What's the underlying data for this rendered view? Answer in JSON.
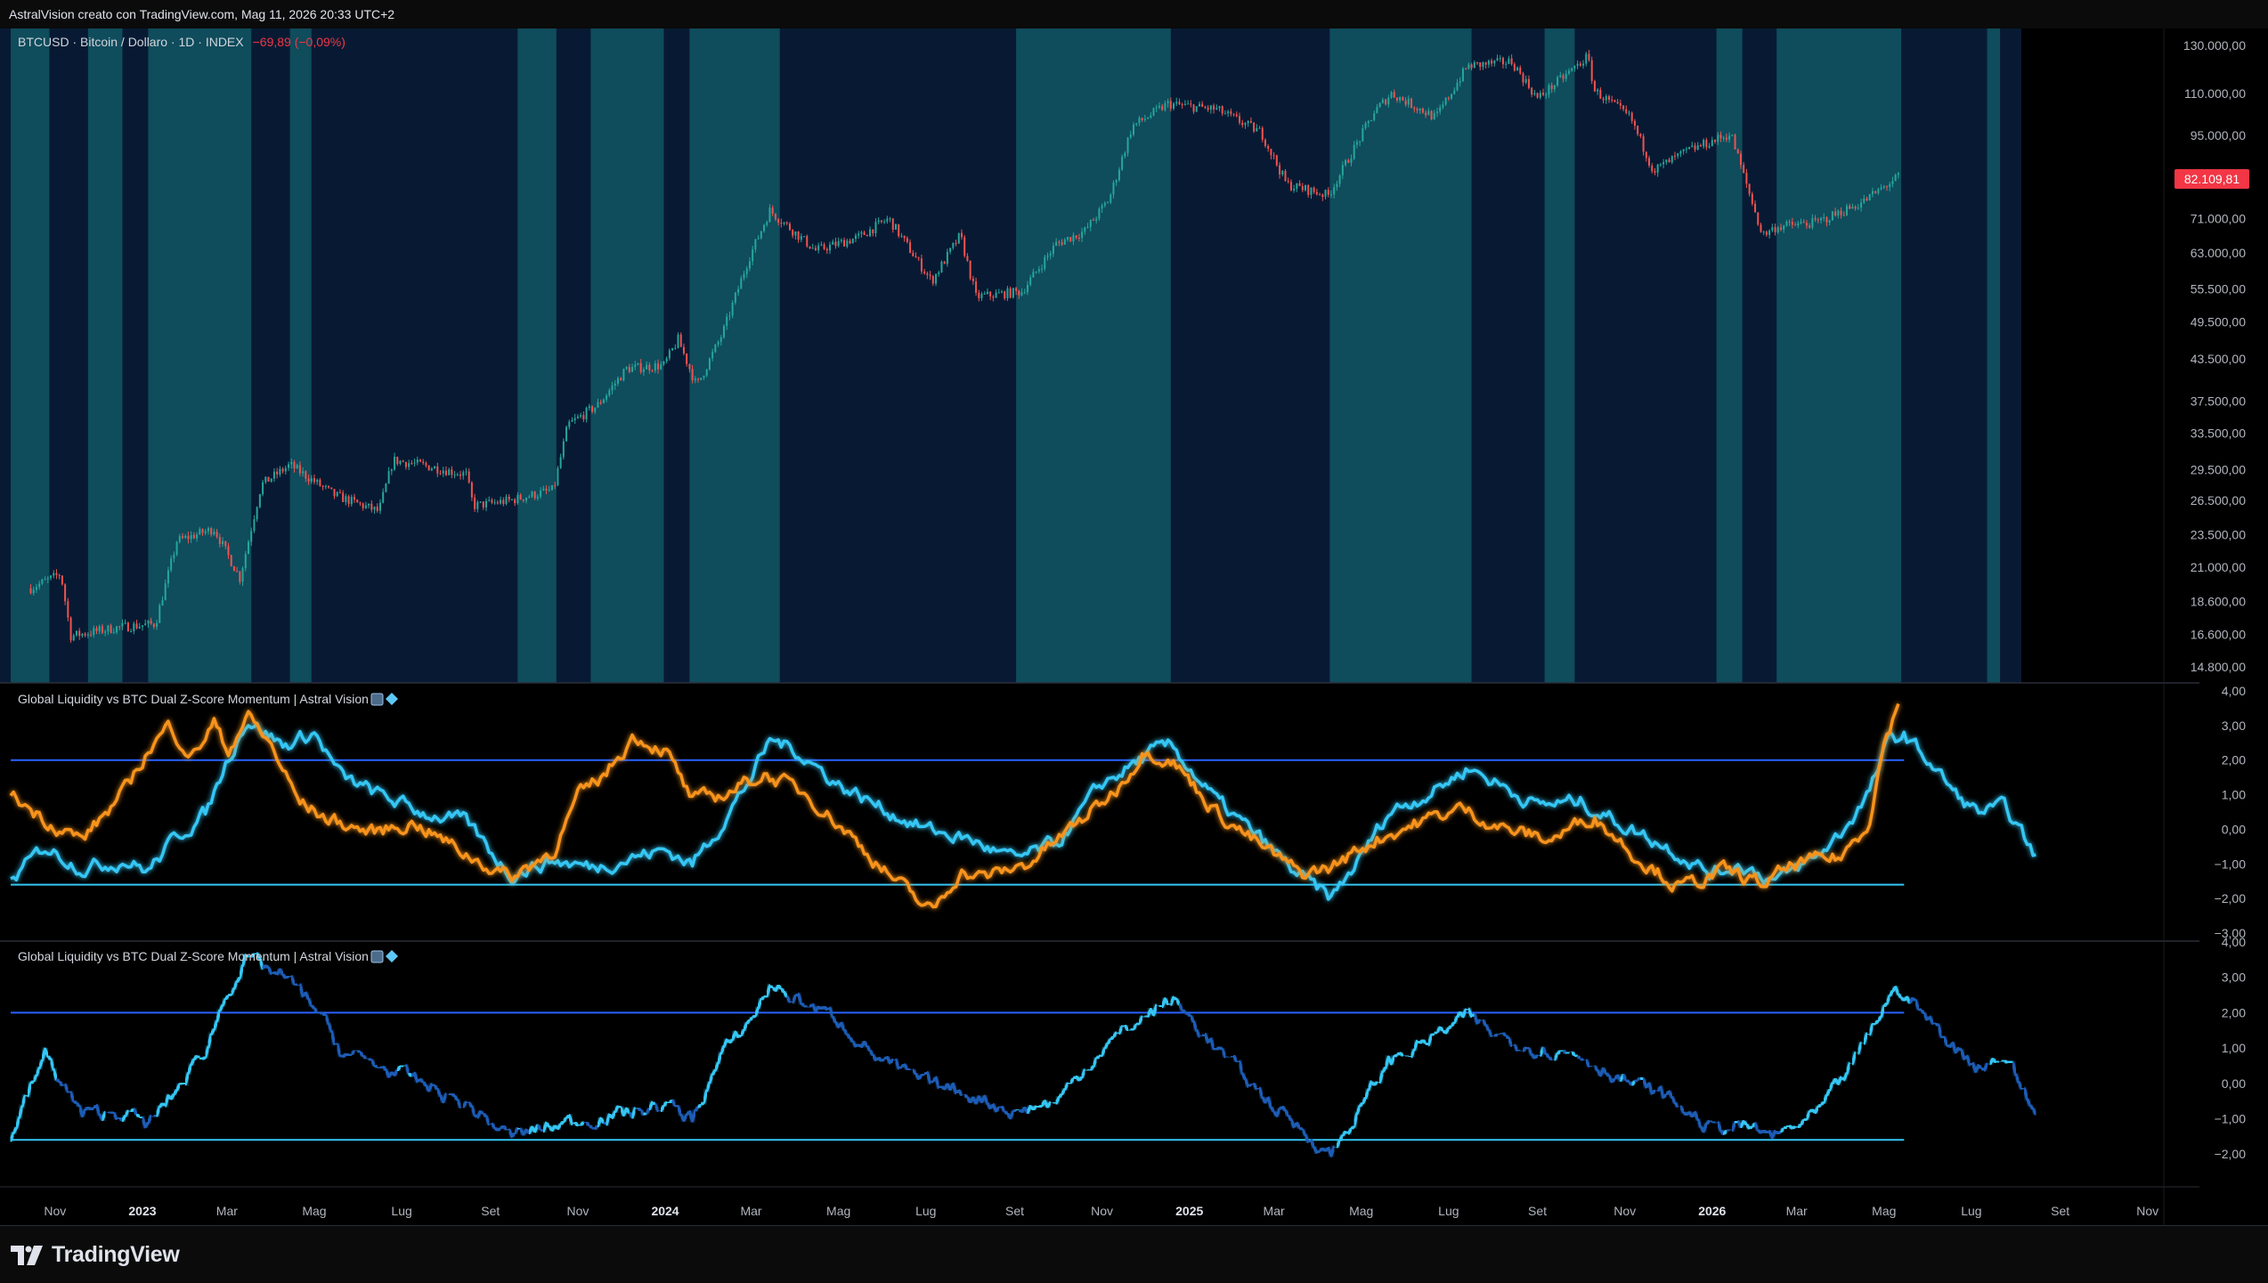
{
  "header": {
    "attribution": "AstralVision creato con TradingView.com, Mag 11, 2026 20:33 UTC+2"
  },
  "main_pane": {
    "legend": "BTCUSD · Bitcoin / Dollaro · 1D · INDEX",
    "change": "−69,89 (−0,09%)",
    "last_price_label": "82.109,81",
    "price_axis_labels": [
      "130.000,00",
      "110.000,00",
      "95.000,00",
      "82.109,81",
      "71.000,00",
      "63.000,00",
      "55.500,00",
      "49.500,00",
      "43.500,00",
      "37.500,00",
      "33.500,00",
      "29.500,00",
      "26.500,00",
      "23.500,00",
      "21.000,00",
      "18.600,00",
      "16.600,00",
      "14.800,00"
    ]
  },
  "pane2": {
    "title": "Global Liquidity vs BTC Dual Z-Score Momentum | Astral Vision",
    "axis_labels": [
      "4,00",
      "3,00",
      "2,00",
      "1,00",
      "0,00",
      "−1,00",
      "−2,00",
      "−3,00"
    ]
  },
  "pane3": {
    "title": "Global Liquidity vs BTC Dual Z-Score Momentum | Astral Vision",
    "axis_labels": [
      "4,00",
      "3,00",
      "2,00",
      "1,00",
      "0,00",
      "−1,00",
      "−2,00"
    ]
  },
  "time_axis": {
    "labels": [
      "Nov",
      "2023",
      "Mar",
      "Mag",
      "Lug",
      "Set",
      "Nov",
      "2024",
      "Mar",
      "Mag",
      "Lug",
      "Set",
      "Nov",
      "2025",
      "Mar",
      "Mag",
      "Lug",
      "Set",
      "Nov",
      "2026",
      "Mar",
      "Mag",
      "Lug",
      "Set",
      "Nov"
    ]
  },
  "footer": {
    "brand": "TradingView"
  },
  "colors": {
    "background": "#000000",
    "regime_teal": "#0f4c5c",
    "regime_navy": "#081a33",
    "candle_up": "#26a69a",
    "candle_down": "#ef5350",
    "price_line": "#b0a7a0",
    "liquidity_z": "#34c6f4",
    "btc_z": "#f7931a",
    "momentum_dark": "#1e5bb5",
    "threshold_line": "#2962ff",
    "last_price_bg": "#f23645"
  },
  "chart_data": [
    {
      "type": "line",
      "title": "BTCUSD · Bitcoin / Dollaro · 1D · INDEX",
      "y_scale": "log",
      "ylim": [
        14000,
        138000
      ],
      "series": [
        {
          "name": "BTCUSD",
          "x": [
            "2022-10-15",
            "2022-11-05",
            "2022-11-12",
            "2022-12-15",
            "2023-01-10",
            "2023-01-25",
            "2023-02-20",
            "2023-03-10",
            "2023-03-25",
            "2023-04-14",
            "2023-05-15",
            "2023-06-15",
            "2023-06-25",
            "2023-07-15",
            "2023-08-15",
            "2023-08-20",
            "2023-09-15",
            "2023-10-15",
            "2023-10-25",
            "2023-11-15",
            "2023-12-05",
            "2023-12-31",
            "2024-01-10",
            "2024-01-23",
            "2024-02-10",
            "2024-02-28",
            "2024-03-14",
            "2024-04-15",
            "2024-05-15",
            "2024-06-05",
            "2024-07-05",
            "2024-07-25",
            "2024-08-05",
            "2024-09-06",
            "2024-09-30",
            "2024-10-20",
            "2024-11-06",
            "2024-11-22",
            "2024-12-17",
            "2025-01-20",
            "2025-02-20",
            "2025-03-10",
            "2025-04-08",
            "2025-05-10",
            "2025-05-22",
            "2025-06-22",
            "2025-07-14",
            "2025-08-14",
            "2025-09-01",
            "2025-10-06",
            "2025-10-11",
            "2025-11-05",
            "2025-11-21",
            "2025-12-15",
            "2026-01-14",
            "2026-02-05",
            "2026-02-15",
            "2026-03-15",
            "2026-04-15",
            "2026-05-11"
          ],
          "y": [
            19500,
            20500,
            16500,
            17000,
            17200,
            23000,
            24000,
            20200,
            28000,
            30000,
            27000,
            25500,
            30500,
            30000,
            29000,
            26000,
            26500,
            27500,
            34500,
            37000,
            42000,
            42500,
            46500,
            39500,
            47500,
            61500,
            73000,
            63500,
            66500,
            71000,
            57000,
            67000,
            54000,
            55000,
            65000,
            68000,
            76000,
            98000,
            106000,
            104000,
            96000,
            80000,
            77000,
            103000,
            110000,
            101000,
            121000,
            123000,
            108000,
            125000,
            111000,
            101000,
            84000,
            90000,
            95500,
            67000,
            69000,
            70000,
            75000,
            82110
          ]
        }
      ]
    },
    {
      "type": "line",
      "title": "Global Liquidity vs BTC Dual Z-Score Momentum | Astral Vision",
      "ylim": [
        -3,
        4
      ],
      "upper_threshold": 2,
      "lower_threshold": -1.6,
      "series": [
        {
          "name": "Global Liquidity",
          "x": [
            "2022-10-01",
            "2022-10-25",
            "2022-11-20",
            "2022-12-20",
            "2023-01-05",
            "2023-01-25",
            "2023-02-15",
            "2023-03-01",
            "2023-03-15",
            "2023-04-10",
            "2023-05-01",
            "2023-05-20",
            "2023-06-15",
            "2023-07-15",
            "2023-08-15",
            "2023-09-15",
            "2023-10-15",
            "2023-11-10",
            "2023-12-10",
            "2024-01-01",
            "2024-01-20",
            "2024-02-10",
            "2024-03-01",
            "2024-03-15",
            "2024-04-01",
            "2024-05-01",
            "2024-06-01",
            "2024-07-01",
            "2024-08-01",
            "2024-09-01",
            "2024-10-01",
            "2024-11-01",
            "2024-12-05",
            "2024-12-20",
            "2025-01-20",
            "2025-02-20",
            "2025-03-20",
            "2025-04-10",
            "2025-05-01",
            "2025-05-20",
            "2025-06-20",
            "2025-07-15",
            "2025-08-01",
            "2025-09-01",
            "2025-10-01",
            "2025-11-01",
            "2025-12-01",
            "2026-01-01",
            "2026-01-20",
            "2026-02-15",
            "2026-03-15",
            "2026-04-01",
            "2026-04-20",
            "2026-05-05",
            "2026-05-15",
            "2026-06-01",
            "2026-06-20",
            "2026-07-05",
            "2026-07-25",
            "2026-08-15"
          ],
          "y": [
            -1.5,
            -0.5,
            -1.1,
            -0.9,
            -1.2,
            -0.2,
            0.5,
            2.0,
            3.2,
            2.4,
            2.8,
            1.5,
            1.0,
            0.5,
            0.2,
            -1.3,
            -0.9,
            -1.1,
            -0.8,
            -0.6,
            -1.0,
            0.2,
            1.5,
            2.6,
            2.3,
            1.3,
            0.6,
            0.0,
            -0.3,
            -0.9,
            -0.4,
            1.3,
            2.2,
            2.4,
            0.8,
            -0.3,
            -1.4,
            -2.0,
            -0.8,
            0.5,
            1.1,
            1.8,
            1.4,
            0.7,
            0.8,
            0.1,
            -0.5,
            -1.3,
            -1.0,
            -1.5,
            -0.8,
            -0.1,
            1.0,
            2.6,
            2.7,
            2.0,
            1.0,
            0.5,
            0.6,
            -0.8
          ]
        },
        {
          "name": "BTC",
          "x": [
            "2022-10-01",
            "2022-10-25",
            "2022-11-20",
            "2022-12-20",
            "2023-01-05",
            "2023-01-20",
            "2023-02-05",
            "2023-02-20",
            "2023-03-01",
            "2023-03-15",
            "2023-04-01",
            "2023-04-20",
            "2023-05-10",
            "2023-06-10",
            "2023-07-10",
            "2023-08-10",
            "2023-09-15",
            "2023-10-15",
            "2023-11-01",
            "2023-11-20",
            "2023-12-10",
            "2024-01-01",
            "2024-01-20",
            "2024-02-10",
            "2024-03-10",
            "2024-04-10",
            "2024-05-10",
            "2024-06-10",
            "2024-07-05",
            "2024-07-25",
            "2024-08-10",
            "2024-09-10",
            "2024-10-10",
            "2024-11-10",
            "2024-12-01",
            "2024-12-20",
            "2025-01-20",
            "2025-02-20",
            "2025-03-20",
            "2025-04-10",
            "2025-05-10",
            "2025-06-10",
            "2025-07-10",
            "2025-08-10",
            "2025-09-10",
            "2025-10-10",
            "2025-11-10",
            "2025-12-10",
            "2026-01-10",
            "2026-02-05",
            "2026-03-01",
            "2026-04-01",
            "2026-04-20",
            "2026-05-01",
            "2026-05-11"
          ],
          "y": [
            1.0,
            0.3,
            -0.3,
            1.1,
            2.3,
            3.0,
            2.1,
            3.1,
            2.2,
            3.3,
            2.4,
            0.8,
            0.3,
            -0.1,
            0.2,
            -0.6,
            -1.4,
            -0.6,
            0.9,
            1.6,
            2.7,
            2.3,
            0.8,
            1.0,
            1.6,
            1.0,
            -0.2,
            -1.5,
            -2.4,
            -1.2,
            -1.4,
            -1.0,
            0.0,
            1.1,
            2.3,
            2.0,
            0.5,
            -0.5,
            -1.3,
            -1.1,
            -0.3,
            0.2,
            0.6,
            0.0,
            -0.3,
            0.4,
            -0.8,
            -1.7,
            -1.2,
            -1.6,
            -1.0,
            -0.8,
            0.2,
            2.5,
            3.6
          ]
        }
      ]
    },
    {
      "type": "line",
      "title": "Global Liquidity vs BTC Dual Z-Score Momentum | Astral Vision",
      "ylim": [
        -2.5,
        4
      ],
      "upper_threshold": 2,
      "lower_threshold": -1.6,
      "series": [
        {
          "name": "Momentum",
          "x": [
            "2022-10-01",
            "2022-10-25",
            "2022-11-20",
            "2022-12-20",
            "2023-01-05",
            "2023-01-25",
            "2023-02-15",
            "2023-03-01",
            "2023-03-15",
            "2023-04-10",
            "2023-05-01",
            "2023-05-20",
            "2023-06-15",
            "2023-07-15",
            "2023-08-15",
            "2023-09-15",
            "2023-10-15",
            "2023-11-10",
            "2023-12-10",
            "2024-01-01",
            "2024-01-20",
            "2024-02-10",
            "2024-03-01",
            "2024-03-15",
            "2024-04-01",
            "2024-05-01",
            "2024-06-01",
            "2024-07-01",
            "2024-08-01",
            "2024-09-01",
            "2024-10-01",
            "2024-11-01",
            "2024-12-05",
            "2024-12-20",
            "2025-01-20",
            "2025-02-20",
            "2025-03-20",
            "2025-04-10",
            "2025-05-01",
            "2025-05-20",
            "2025-06-20",
            "2025-07-15",
            "2025-08-01",
            "2025-09-01",
            "2025-10-01",
            "2025-11-01",
            "2025-12-01",
            "2026-01-01",
            "2026-01-20",
            "2026-02-15",
            "2026-03-15",
            "2026-04-01",
            "2026-04-20",
            "2026-05-05",
            "2026-05-15",
            "2026-06-01",
            "2026-06-20",
            "2026-07-05",
            "2026-07-25",
            "2026-08-15"
          ],
          "y": [
            -1.5,
            0.8,
            -0.9,
            -0.8,
            -1.2,
            -0.2,
            1.0,
            2.6,
            3.5,
            3.0,
            2.2,
            0.9,
            0.5,
            0.0,
            -0.6,
            -1.5,
            -1.2,
            -1.0,
            -0.8,
            -0.6,
            -1.0,
            0.8,
            1.8,
            2.8,
            2.4,
            1.8,
            0.6,
            0.0,
            -0.3,
            -0.8,
            -0.5,
            1.0,
            2.0,
            2.4,
            1.0,
            -0.3,
            -1.3,
            -2.0,
            -0.7,
            0.6,
            1.3,
            1.9,
            1.4,
            1.0,
            0.8,
            0.1,
            -0.4,
            -1.3,
            -1.2,
            -1.5,
            -0.9,
            0.0,
            1.3,
            2.5,
            2.6,
            1.8,
            1.0,
            0.5,
            0.8,
            -0.9
          ]
        }
      ]
    }
  ]
}
